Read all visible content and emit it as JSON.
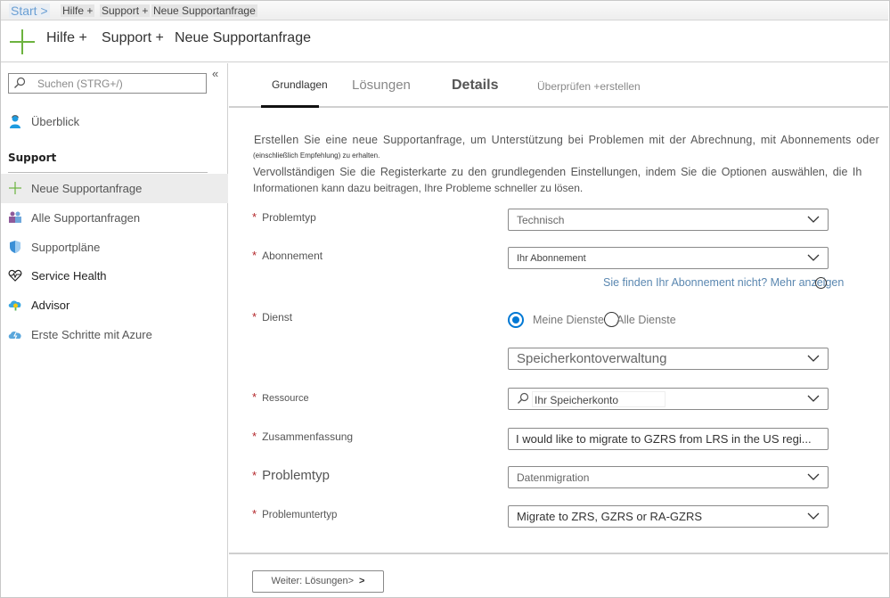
{
  "breadcrumb": {
    "start": "Start >",
    "items": [
      "Hilfe +",
      "Support +",
      "Neue Supportanfrage"
    ]
  },
  "header": {
    "parts": [
      "Hilfe +",
      "Support +",
      "Neue Supportanfrage"
    ]
  },
  "sidebar": {
    "collapse": "«",
    "search_placeholder": "Suchen (STRG+/)",
    "overview": "Überblick",
    "section_title": "Support",
    "items": [
      {
        "label": "Neue Supportanfrage",
        "icon": "plus-icon",
        "active": true
      },
      {
        "label": "Alle Supportanfragen",
        "icon": "support-requests-icon"
      },
      {
        "label": "Supportpläne",
        "icon": "shield-icon"
      },
      {
        "label": "Service Health",
        "icon": "heart-pulse-icon"
      },
      {
        "label": "Advisor",
        "icon": "advisor-cloud-icon"
      },
      {
        "label": "Erste Schritte mit Azure",
        "icon": "cloud-bolt-icon"
      }
    ]
  },
  "tabs": [
    {
      "label": "Grundlagen",
      "active": true
    },
    {
      "label": "Lösungen"
    },
    {
      "label": "Details"
    },
    {
      "label": "Überprüfen +erstellen"
    }
  ],
  "intro": {
    "line1": "Erstellen Sie eine neue Supportanfrage, um Unterstützung bei Problemen mit der Abrechnung, mit Abonnements oder",
    "line_small": "(einschließlich Empfehlung) zu erhalten.",
    "line2": "Vervollständigen Sie die Registerkarte zu den grundlegenden Einstellungen, indem Sie die Optionen auswählen, die Ih",
    "line3": "Informationen kann dazu beitragen, Ihre Probleme schneller zu lösen."
  },
  "form": {
    "required_mark": "*",
    "problem_type": {
      "label": "Problemtyp",
      "value": "Technisch"
    },
    "subscription": {
      "label": "Abonnement",
      "value": "Ihr Abonnement",
      "help_link": "Sie finden Ihr Abonnement nicht? Mehr anzeigen"
    },
    "service": {
      "label": "Dienst",
      "radio_options": [
        "Meine Dienste",
        "Alle Dienste"
      ],
      "selected_radio": "Meine Dienste",
      "value": "Speicherkontoverwaltung"
    },
    "resource": {
      "label": "Ressource",
      "value": "Ihr Speicherkonto"
    },
    "summary": {
      "label": "Zusammenfassung",
      "value": "I would like to migrate to GZRS from LRS in the US regi..."
    },
    "problem_type2": {
      "label": "Problemtyp",
      "value": "Datenmigration"
    },
    "problem_subtype": {
      "label": "Problemuntertyp",
      "value": "Migrate to ZRS, GZRS or RA-GZRS"
    }
  },
  "footer": {
    "next_button": "Weiter: Lösungen>",
    "next_arrow": ">"
  },
  "colors": {
    "accent": "#0078d4",
    "required": "#b3262a",
    "link": "#5a87b0",
    "plus_green": "#6cb33e"
  }
}
